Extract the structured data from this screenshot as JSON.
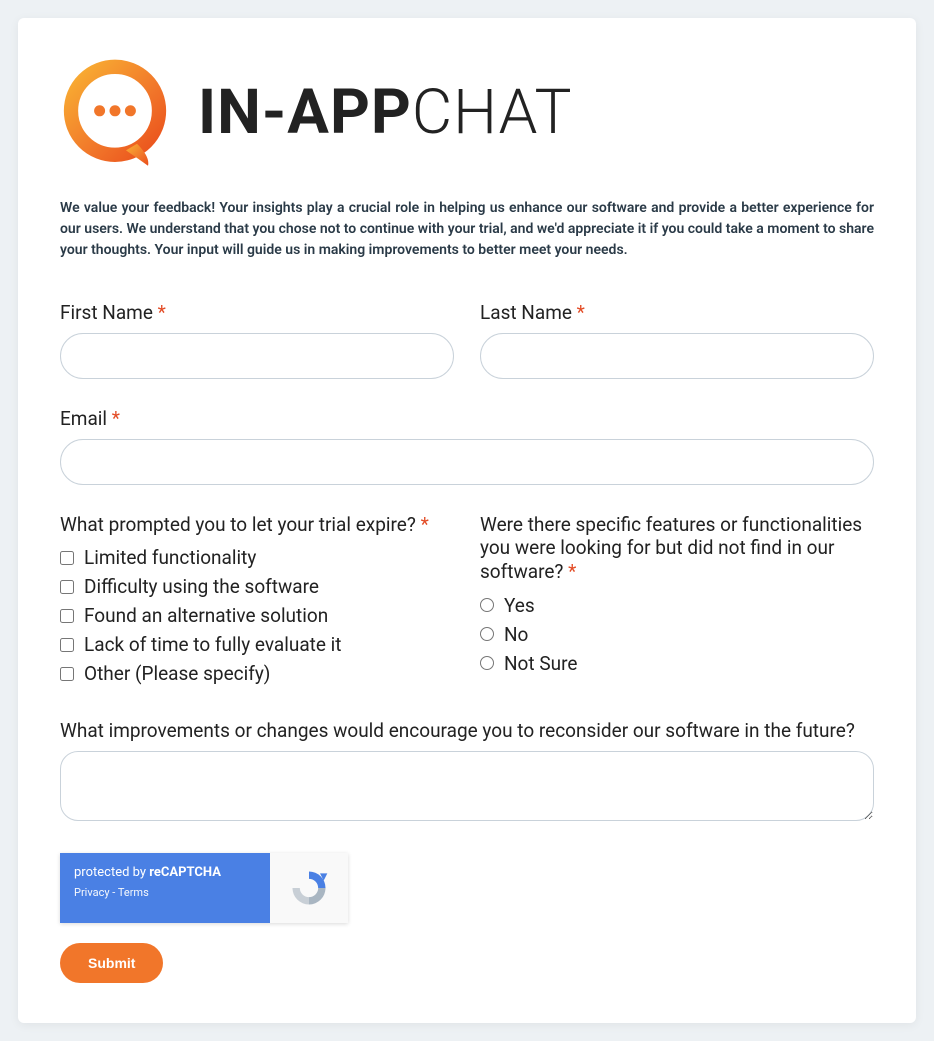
{
  "logo": {
    "text_bold": "IN-APP",
    "text_thin": "CHAT"
  },
  "intro": "We value your feedback! Your insights play a crucial role in helping us enhance our software and provide a better experience for our users. We understand that you chose not to continue with your trial, and we'd appreciate it if you could take a moment to share your thoughts. Your input will guide us in making improvements to better meet your needs.",
  "fields": {
    "first_name": {
      "label": "First Name",
      "required": "*",
      "value": ""
    },
    "last_name": {
      "label": "Last Name",
      "required": "*",
      "value": ""
    },
    "email": {
      "label": "Email",
      "required": "*",
      "value": ""
    },
    "prompt_expire": {
      "label": "What prompted you to let your trial expire?",
      "required": "*",
      "options": [
        "Limited functionality",
        "Difficulty using the software",
        "Found an alternative solution",
        "Lack of time to fully evaluate it",
        "Other (Please specify)"
      ]
    },
    "features_missing": {
      "label": "Were there specific features or functionalities you were looking for but did not find in our software?",
      "required": "*",
      "options": [
        "Yes",
        "No",
        "Not Sure"
      ]
    },
    "improvements": {
      "label": "What improvements or changes would encourage you to reconsider our software in the future?",
      "value": ""
    }
  },
  "recaptcha": {
    "line1_prefix": "protected by ",
    "line1_bold": "reCAPTCHA",
    "privacy": "Privacy",
    "sep": " - ",
    "terms": "Terms"
  },
  "submit_label": "Submit"
}
